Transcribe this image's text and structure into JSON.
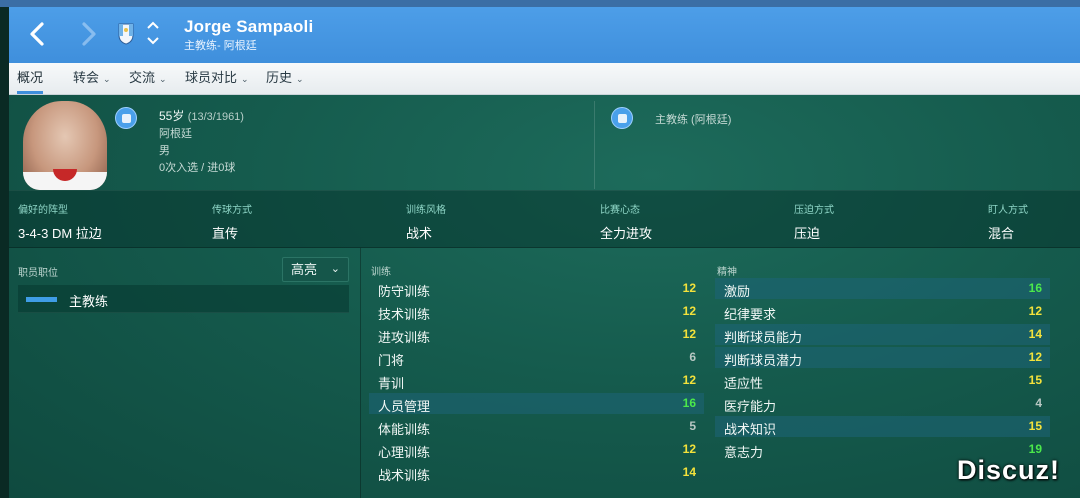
{
  "header": {
    "name": "Jorge Sampaoli",
    "subtitle": "主教练- 阿根廷"
  },
  "tabs": [
    {
      "label": "概况",
      "chevron": false
    },
    {
      "label": "转会",
      "chevron": true
    },
    {
      "label": "交流",
      "chevron": true
    },
    {
      "label": "球员对比",
      "chevron": true
    },
    {
      "label": "历史",
      "chevron": true
    }
  ],
  "profile": {
    "age": "55岁",
    "dob": "(13/3/1961)",
    "nation": "阿根廷",
    "gender": "男",
    "caps": "0次入选 / 进0球",
    "job": "主教练 (阿根廷)"
  },
  "tactics": [
    {
      "label": "偏好的阵型",
      "value": "3-4-3 DM 拉边"
    },
    {
      "label": "传球方式",
      "value": "直传"
    },
    {
      "label": "训练风格",
      "value": "战术"
    },
    {
      "label": "比赛心态",
      "value": "全力进攻"
    },
    {
      "label": "压迫方式",
      "value": "压迫"
    },
    {
      "label": "盯人方式",
      "value": "混合"
    }
  ],
  "roles": {
    "label": "职员职位",
    "dropdown": "高亮",
    "role": "主教练"
  },
  "training": {
    "heading": "训练",
    "items": [
      {
        "name": "防守训练",
        "value": "12",
        "color": "y"
      },
      {
        "name": "技术训练",
        "value": "12",
        "color": "y"
      },
      {
        "name": "进攻训练",
        "value": "12",
        "color": "y"
      },
      {
        "name": "门将",
        "value": "6",
        "color": "gr"
      },
      {
        "name": "青训",
        "value": "12",
        "color": "y"
      },
      {
        "name": "人员管理",
        "value": "16",
        "color": "g"
      },
      {
        "name": "体能训练",
        "value": "5",
        "color": "gr"
      },
      {
        "name": "心理训练",
        "value": "12",
        "color": "y"
      },
      {
        "name": "战术训练",
        "value": "14",
        "color": "y"
      }
    ]
  },
  "mental": {
    "heading": "精神",
    "items": [
      {
        "name": "激励",
        "value": "16",
        "color": "g"
      },
      {
        "name": "纪律要求",
        "value": "12",
        "color": "y"
      },
      {
        "name": "判断球员能力",
        "value": "14",
        "color": "y"
      },
      {
        "name": "判断球员潜力",
        "value": "12",
        "color": "y"
      },
      {
        "name": "适应性",
        "value": "15",
        "color": "y"
      },
      {
        "name": "医疗能力",
        "value": "4",
        "color": "gr"
      },
      {
        "name": "战术知识",
        "value": "15",
        "color": "y"
      },
      {
        "name": "意志力",
        "value": "19",
        "color": "g"
      }
    ]
  },
  "watermark": "Discuz!"
}
